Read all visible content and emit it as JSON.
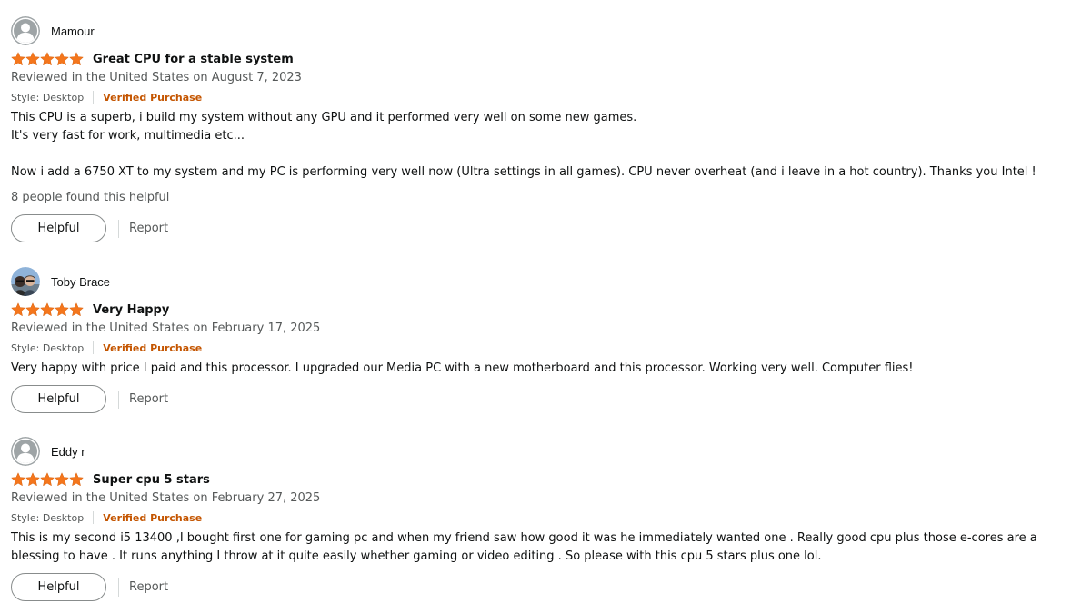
{
  "reviews": [
    {
      "reviewer": "Mamour",
      "avatar": "default-avatar-icon",
      "rating": 5,
      "title": "Great CPU for a stable system",
      "date": "Reviewed in the United States on August 7, 2023",
      "style": "Style: Desktop",
      "verified": "Verified Purchase",
      "body": [
        "This CPU is a superb, i build my system without any GPU and it performed very well on some new games.",
        "It's very fast for work, multimedia etc...",
        "",
        "Now i add a 6750 XT to my system and my PC is performing very well now (Ultra settings in all games). CPU never overheat (and i leave in a hot country). Thanks you Intel !"
      ],
      "helpful_count": "8 people found this helpful",
      "helpful_label": "Helpful",
      "report_label": "Report"
    },
    {
      "reviewer": "Toby Brace",
      "avatar": "photo-avatar",
      "rating": 5,
      "title": "Very Happy",
      "date": "Reviewed in the United States on February 17, 2025",
      "style": "Style: Desktop",
      "verified": "Verified Purchase",
      "body": [
        "Very happy with price I paid and this processor. I upgraded our Media PC with a new motherboard and this processor. Working very well. Computer flies!"
      ],
      "helpful_label": "Helpful",
      "report_label": "Report"
    },
    {
      "reviewer": "Eddy r",
      "avatar": "default-avatar-icon",
      "rating": 5,
      "title": "Super cpu 5 stars",
      "date": "Reviewed in the United States on February 27, 2025",
      "style": "Style: Desktop",
      "verified": "Verified Purchase",
      "body": [
        "This is my second i5 13400 ,I bought first one for gaming pc and when my friend saw how good it was he immediately wanted one . Really good cpu plus those e-cores are a",
        "blessing to have . It runs anything I throw at it quite easily whether gaming or video editing . So please with this cpu 5 stars plus one lol."
      ],
      "helpful_label": "Helpful",
      "report_label": "Report"
    }
  ],
  "colors": {
    "star": "#f4761c",
    "verified": "#c45500",
    "muted": "#565959",
    "text": "#0f1111"
  }
}
